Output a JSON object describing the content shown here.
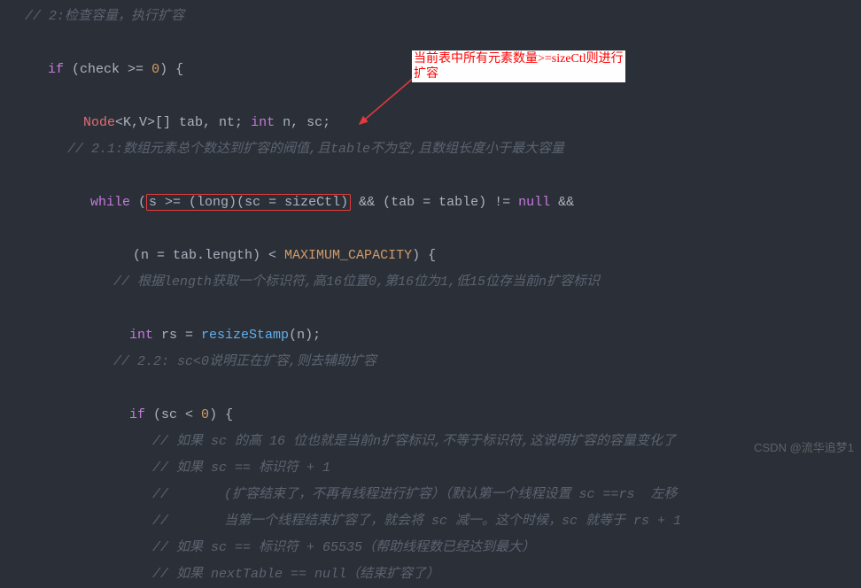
{
  "lines": {
    "c1": "// 2:检查容量，执行扩容",
    "if_kw": "if",
    "if_rest": " (check >= ",
    "zero": "0",
    "if_close": ") {",
    "decl_type1": "Node",
    "decl_rest": "<K,V>[] ",
    "decl_vars": "tab, nt;",
    "int_kw": " int ",
    "decl_vars2": "n, sc;",
    "c2": "// 2.1:数组元素总个数达到扩容的阀值,且table不为空,且数组长度小于最大容量",
    "while_kw": "while",
    "while_paren": " (",
    "boxed": "s >= (long)(sc = sizeCtl)",
    "while_after": " && (tab = table) != ",
    "null_kw": "null",
    "while_tail": " &&",
    "while_line2_a": "(n = tab.length) < ",
    "maxcap": "MAXIMUM_CAPACITY",
    "while_line2_b": ") {",
    "c3": "// 根据length获取一个标识符,高16位置0,第16位为1,低15位存当前n扩容标识",
    "rs_int": "int ",
    "rs_var": "rs = ",
    "rs_fn": "resizeStamp",
    "rs_tail": "(n);",
    "c4": "// 2.2: sc<0说明正在扩容,则去辅助扩容",
    "if2_kw": "if",
    "if2_rest": " (sc < ",
    "if2_zero": "0",
    "if2_close": ") {",
    "c5": "// 如果 sc 的高 16 位也就是当前n扩容标识,不等于标识符,这说明扩容的容量变化了",
    "c6": "// 如果 sc == 标识符 + 1",
    "c7": "//       (扩容结束了，不再有线程进行扩容）（默认第一个线程设置 sc ==rs  左移",
    "c8": "//       当第一个线程结束扩容了，就会将 sc 减一。这个时候，sc 就等于 rs + 1",
    "c9": "// 如果 sc == 标识符 + 65535（帮助线程数已经达到最大）",
    "c10": "// 如果 nextTable == null（结束扩容了）"
  },
  "callout": "当前表中所有元素数量>=sizeCtl则进行扩容",
  "watermark": "CSDN @流华追梦1"
}
